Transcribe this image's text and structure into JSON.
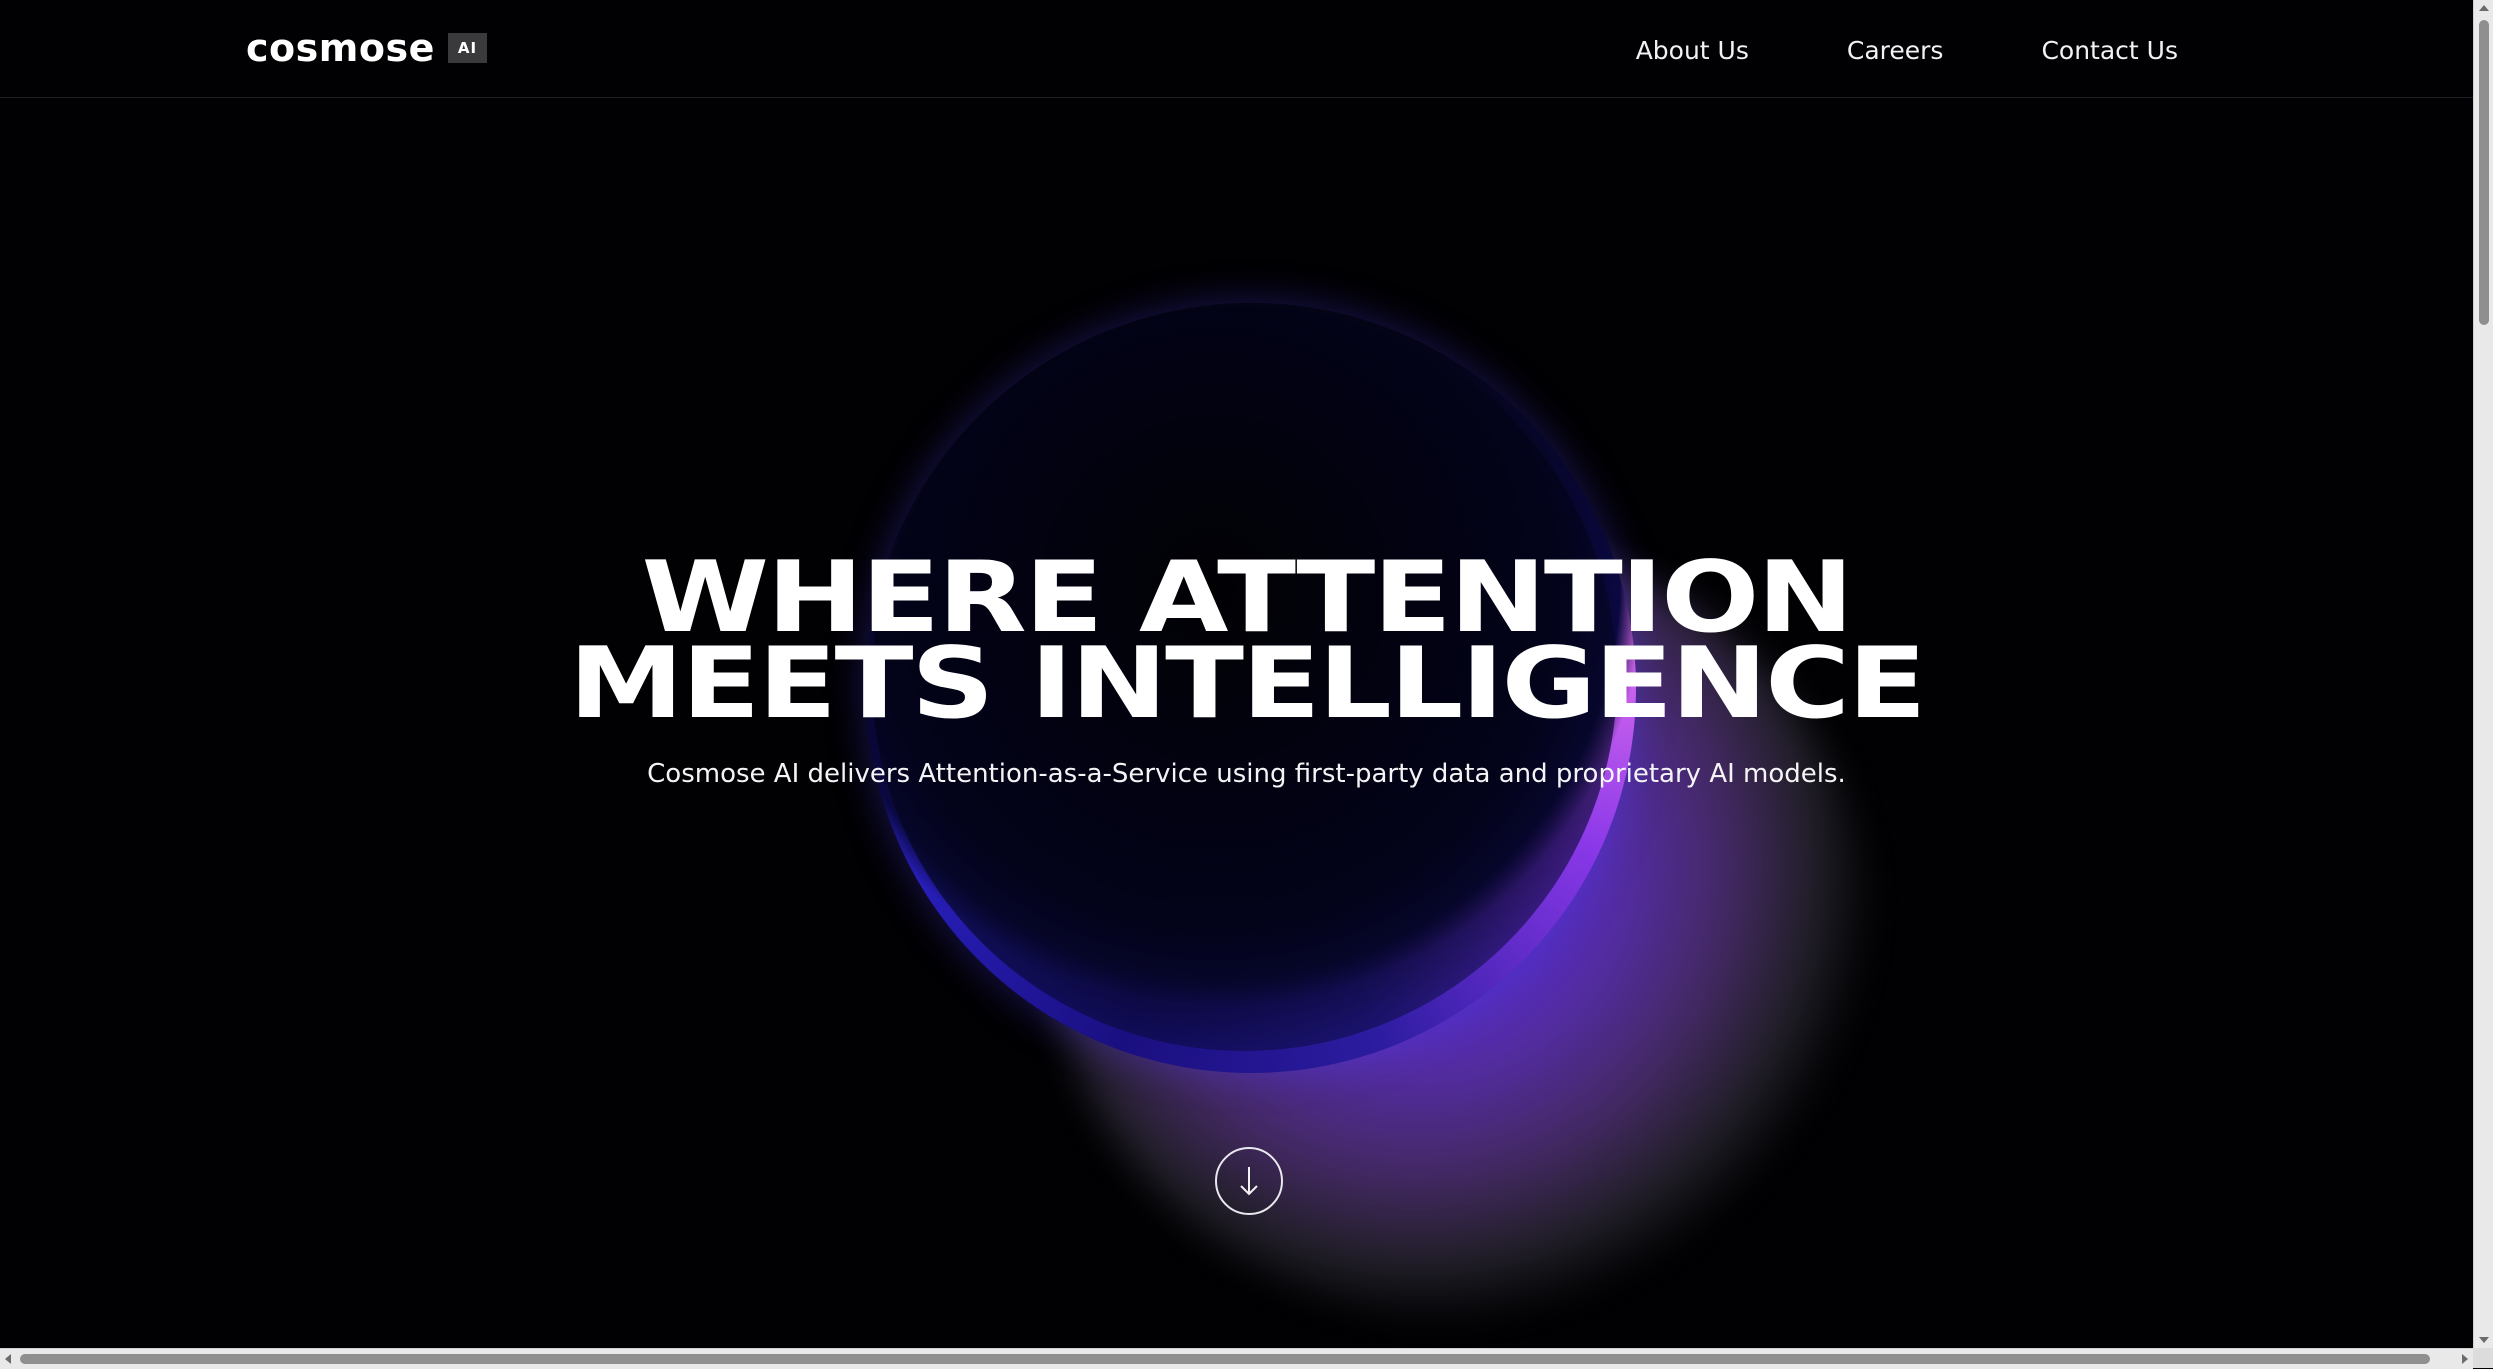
{
  "header": {
    "logo_text": "cosmose",
    "logo_badge": "AI",
    "nav": [
      {
        "label": "About Us"
      },
      {
        "label": "Careers"
      },
      {
        "label": "Contact Us"
      }
    ]
  },
  "hero": {
    "headline_line1": "WHERE ATTENTION",
    "headline_line2": "MEETS INTELLIGENCE",
    "subheadline": "Cosmose AI delivers Attention-as-a-Service using first-party data and proprietary AI models.",
    "scroll_icon": "arrow-down-icon"
  },
  "colors": {
    "background": "#010103",
    "text": "#ffffff",
    "orb_blue": "#3656ff",
    "orb_violet": "#8a40f0",
    "orb_pink": "#f07af0"
  }
}
